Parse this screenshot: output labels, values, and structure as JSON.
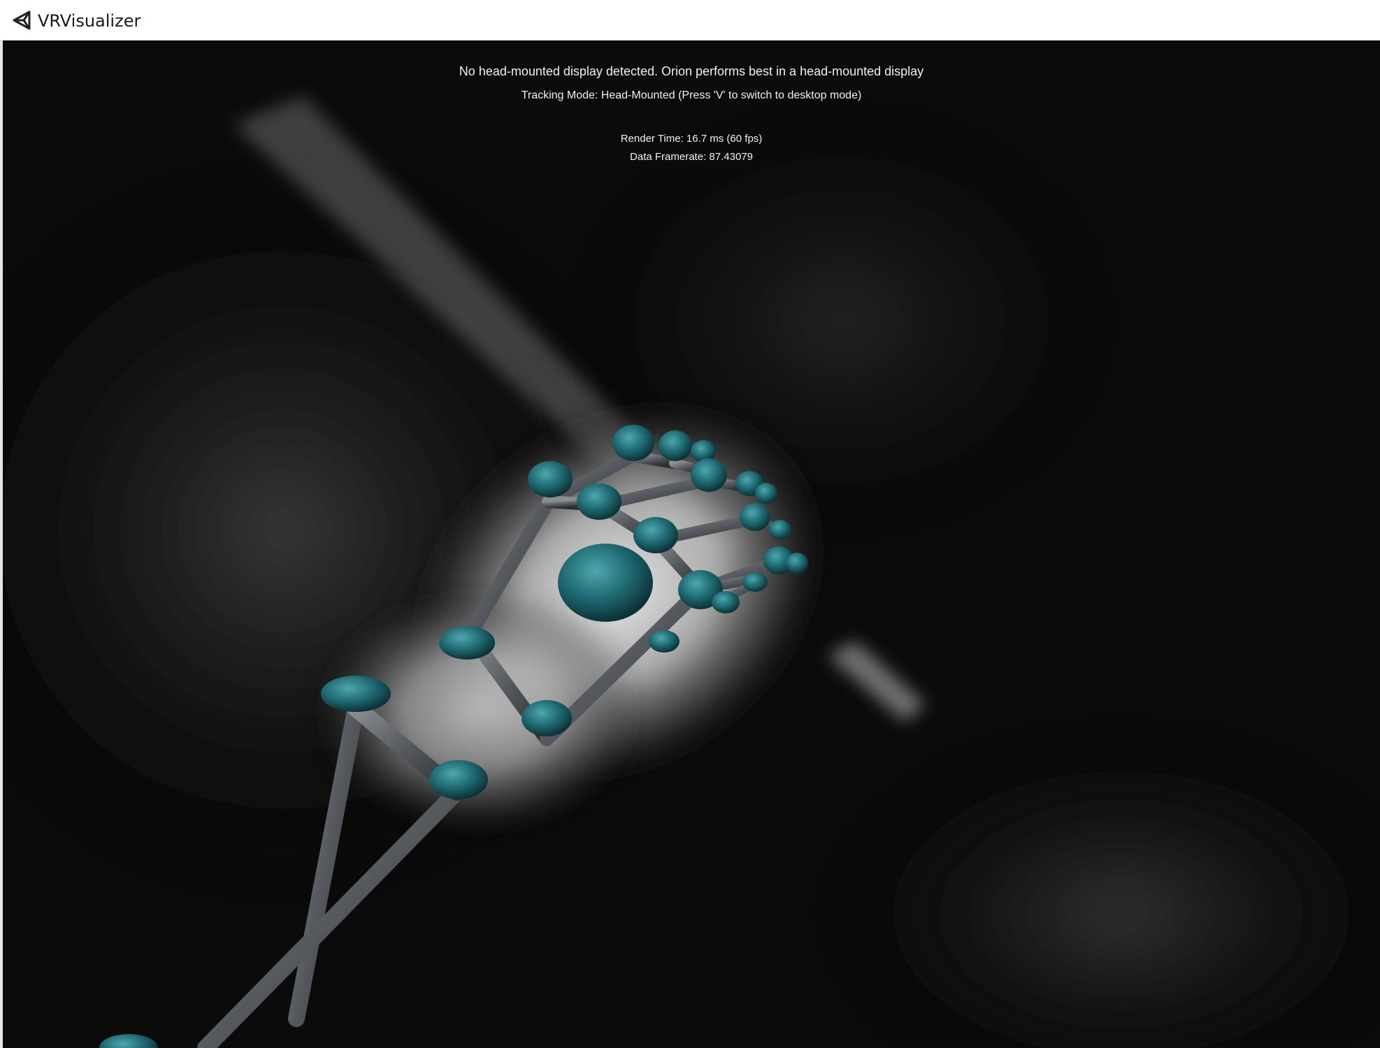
{
  "window": {
    "title": "VRVisualizer",
    "icon": "unity-logo-icon"
  },
  "overlay": {
    "hmd_warning": "No head-mounted display detected. Orion performs best in a head-mounted display",
    "tracking_mode": "Tracking Mode: Head-Mounted (Press 'V' to switch to desktop mode)",
    "render_time": "Render Time: 16.7 ms (60 fps)",
    "data_framerate": "Data Framerate: 87.43079"
  },
  "colors": {
    "joint": "#1f6a72",
    "bone": "#5a5d62",
    "background": "#0b0b0b"
  }
}
